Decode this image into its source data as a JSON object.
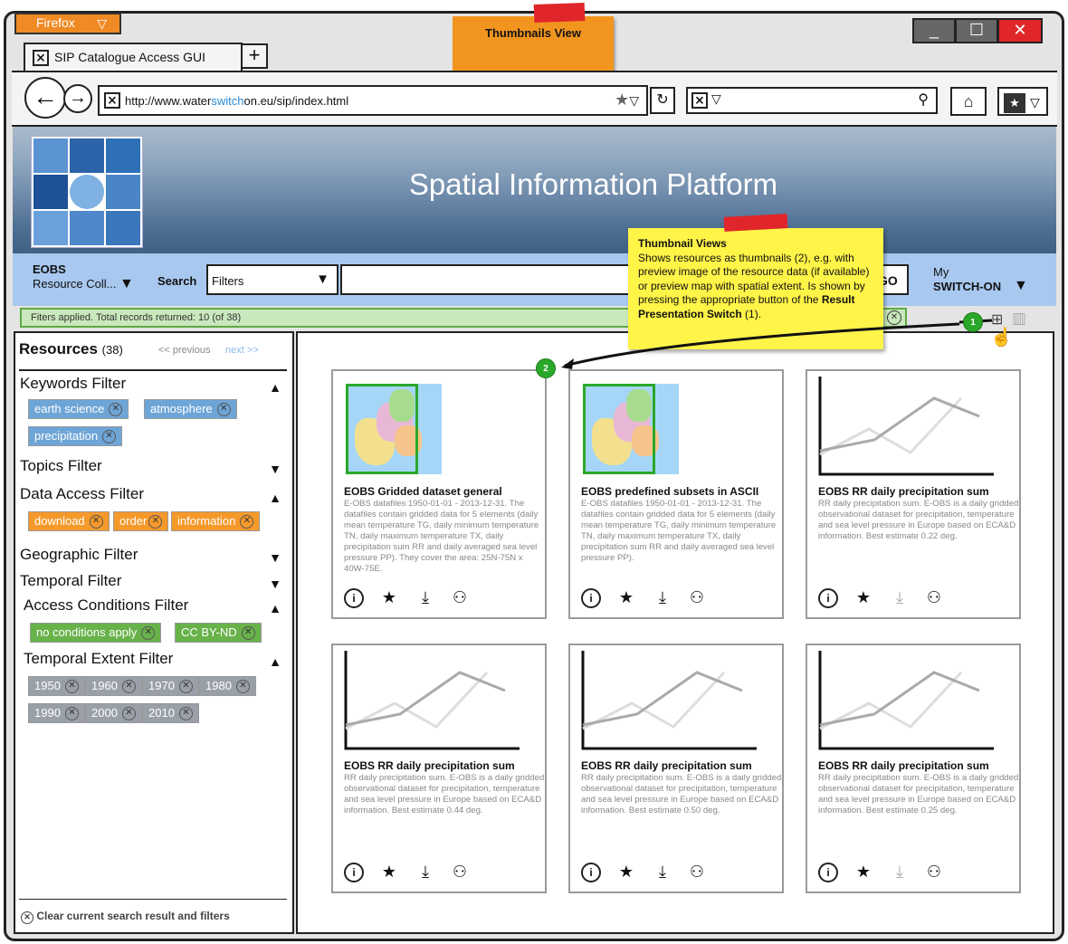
{
  "browser": {
    "menu_label": "Firefox",
    "tab_title": "SIP Catalogue Access GUI",
    "url_prefix": "http://www.water",
    "url_highlight": "switch",
    "url_suffix": "on.eu/sip/index.html"
  },
  "annotations": {
    "top_note": "Thumbnails View",
    "tooltip_title": "Thumbnail Views",
    "tooltip_text": "Shows resources as thumbnails (2), e.g. with preview image of the resource data (if available) or preview map with spatial extent. Is shown by pressing the appropriate button of the",
    "tooltip_bold": "Result Presentation Switch",
    "tooltip_end": "(1).",
    "badge1": "1",
    "badge2": "2"
  },
  "header": {
    "title": "Spatial Information Platform"
  },
  "searchbar": {
    "collection_top": "EOBS",
    "collection_bottom": "Resource Coll...",
    "search_label": "Search",
    "filters_value": "Filters",
    "go_label": "GO",
    "my_top": "My",
    "my_bottom": "SWITCH-ON"
  },
  "status_text": "Fiters applied. Total records returned: 10 (of 38)",
  "sidebar": {
    "resources_label": "Resources",
    "resources_count": "(38)",
    "previous": "<< previous",
    "next": "next >>",
    "keywords": "Keywords Filter",
    "keyword_tags": [
      "earth science",
      "atmosphere",
      "precipitation"
    ],
    "topics": "Topics Filter",
    "data_access": "Data Access Filter",
    "access_tags": [
      "download",
      "order",
      "information"
    ],
    "geographic": "Geographic Filter",
    "temporal": "Temporal Filter",
    "access_conditions": "Access Conditions Filter",
    "condition_tags": [
      "no conditions apply",
      "CC BY-ND"
    ],
    "temporal_extent": "Temporal Extent Filter",
    "year_tags": [
      "1950",
      "1960",
      "1970",
      "1980",
      "1990",
      "2000",
      "2010"
    ],
    "clear_label": "Clear current search result and filters"
  },
  "cards": [
    {
      "title": "EOBS Gridded dataset general",
      "desc": "E-OBS datafiles 1950-01-01 - 2013-12-31. The datafiles contain gridded data for 5 elements (daily mean temperature TG, daily minimum temperature TN, daily maximum temperature TX, daily precipitation sum RR and daily averaged sea level pressure PP). They cover the area: 25N-75N x 40W-75E.",
      "preview": "map"
    },
    {
      "title": "EOBS predefined subsets in ASCII",
      "desc": "E-OBS datafiles 1950-01-01 - 2013-12-31. The datafiles contain gridded data for 5 elements (daily mean temperature TG, daily minimum temperature TN, daily maximum temperature TX, daily precipitation sum RR and daily averaged sea level pressure PP).",
      "preview": "map"
    },
    {
      "title": "EOBS RR daily precipitation sum",
      "desc": "RR daily precipitation sum. E-OBS is a daily gridded observational dataset for precipitation, temperature and sea level pressure in Europe based on ECA&D information. Best estimate 0.22 deg.",
      "preview": "chart"
    },
    {
      "title": "EOBS RR daily precipitation sum",
      "desc": "RR daily precipitation sum. E-OBS is a daily gridded observational dataset for precipitation, temperature and sea level pressure in Europe based on ECA&D information. Best estimate 0.44 deg.",
      "preview": "chart"
    },
    {
      "title": "EOBS RR daily precipitation sum",
      "desc": "RR daily precipitation sum. E-OBS is a daily gridded observational dataset for precipitation, temperature and sea level pressure in Europe based on ECA&D information. Best estimate 0.50 deg.",
      "preview": "chart"
    },
    {
      "title": "EOBS RR daily precipitation sum",
      "desc": "RR daily precipitation sum. E-OBS is a daily gridded observational dataset for precipitation, temperature and sea level pressure in Europe based on ECA&D information. Best estimate 0.25 deg.",
      "preview": "chart"
    }
  ],
  "colors": {
    "accent_orange": "#f08a24",
    "banner_blue": "#a8c8ef",
    "tag_blue": "#6ea5d7",
    "tag_green": "#68b24a",
    "note_yellow": "#fff448"
  }
}
